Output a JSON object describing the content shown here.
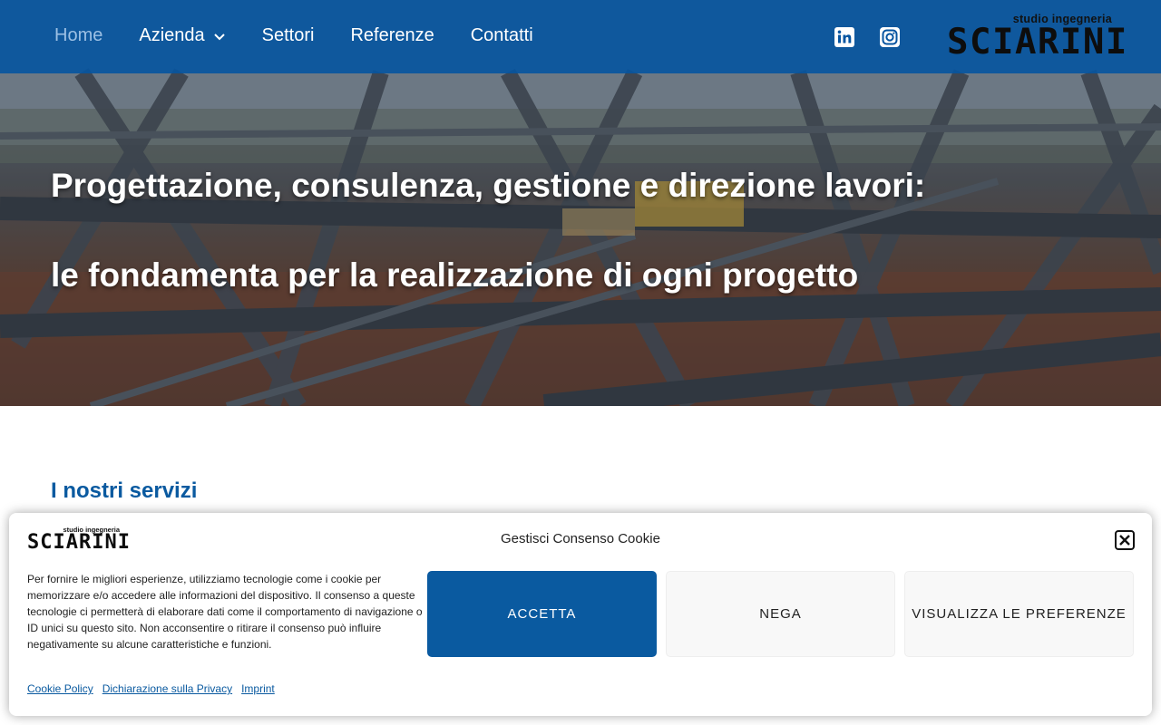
{
  "nav": {
    "items": [
      {
        "label": "Home",
        "active": true
      },
      {
        "label": "Azienda",
        "has_dropdown": true
      },
      {
        "label": "Settori"
      },
      {
        "label": "Referenze"
      },
      {
        "label": "Contatti"
      }
    ],
    "social": [
      "linkedin-icon",
      "instagram-icon"
    ]
  },
  "brand": {
    "tagline": "studio ingegneria",
    "name": "SCIARINI"
  },
  "hero": {
    "line1": "Progettazione, consulenza, gestione e direzione lavori:",
    "line2": "le fondamenta per la realizzazione di ogni progetto"
  },
  "services": {
    "title": "I nostri servizi"
  },
  "cookie": {
    "title": "Gestisci Consenso Cookie",
    "text": "Per fornire le migliori esperienze, utilizziamo tecnologie come i cookie per memorizzare e/o accedere alle informazioni del dispositivo. Il consenso a queste tecnologie ci permetterà di elaborare dati come il comportamento di navigazione o ID unici su questo sito. Non acconsentire o ritirare il consenso può influire negativamente su alcune caratteristiche e funzioni.",
    "accept_label": "ACCETTA",
    "deny_label": "NEGA",
    "prefs_label": "VISUALIZZA LE PREFERENZE",
    "links": [
      "Cookie Policy",
      "Dichiarazione sulla Privacy",
      "Imprint"
    ]
  },
  "colors": {
    "header": "#0654a0",
    "accent": "#0a5aa0",
    "active_nav": "#9cc0e4"
  }
}
